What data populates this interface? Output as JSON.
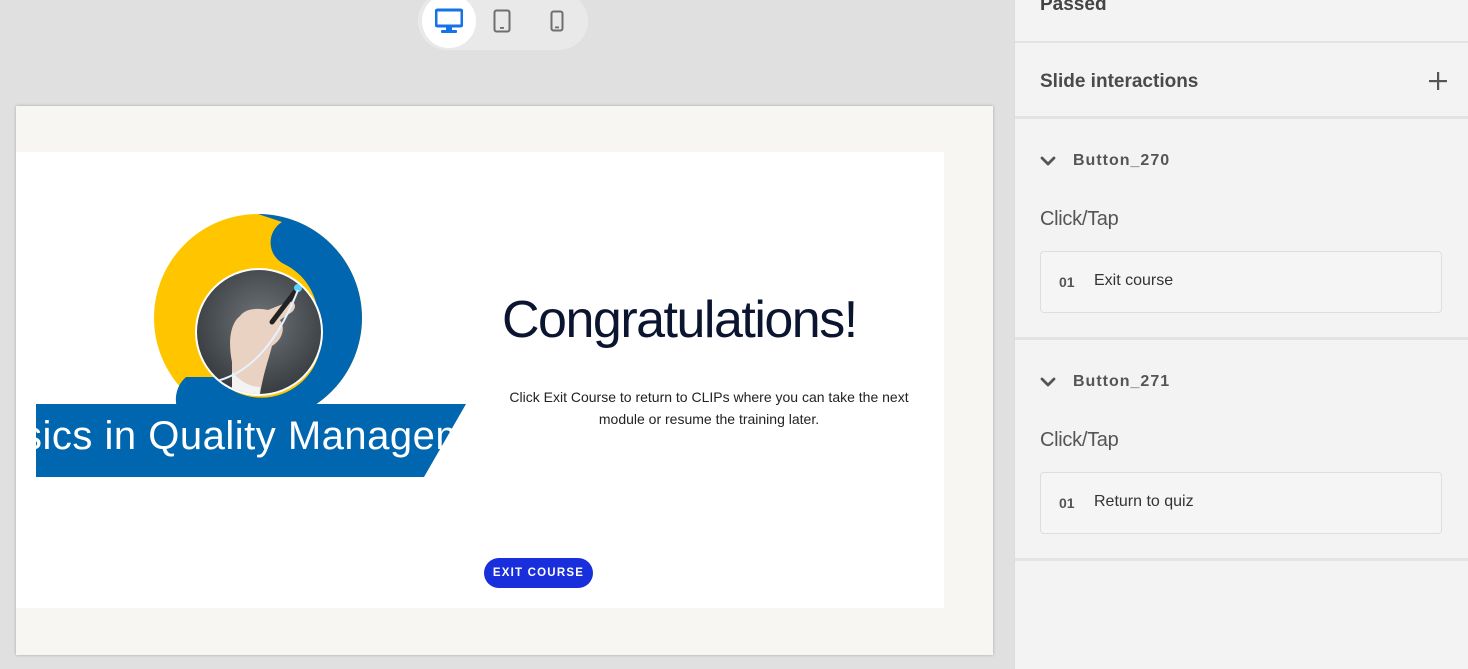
{
  "device_switcher": {
    "desktop_icon": "desktop-icon",
    "tablet_icon": "tablet-icon",
    "mobile_icon": "mobile-icon",
    "active": "desktop"
  },
  "slide": {
    "banner_text": "sics in Quality Management",
    "heading": "Congratulations!",
    "message": "Click Exit Course to return to CLIPs where you can take the next module or resume the training later.",
    "exit_button": "EXIT COURSE"
  },
  "panel": {
    "status": "Passed",
    "interactions_title": "Slide interactions",
    "add_icon": "plus-icon",
    "buttons": [
      {
        "name": "Button_270",
        "trigger": "Click/Tap",
        "actions": [
          {
            "num": "01",
            "label": "Exit course"
          }
        ]
      },
      {
        "name": "Button_271",
        "trigger": "Click/Tap",
        "actions": [
          {
            "num": "01",
            "label": "Return to quiz"
          }
        ]
      }
    ]
  },
  "colors": {
    "logo_yellow": "#FFC600",
    "logo_blue": "#0066B0",
    "exit_button": "#1A2FDC",
    "active_device": "#1473E6"
  }
}
